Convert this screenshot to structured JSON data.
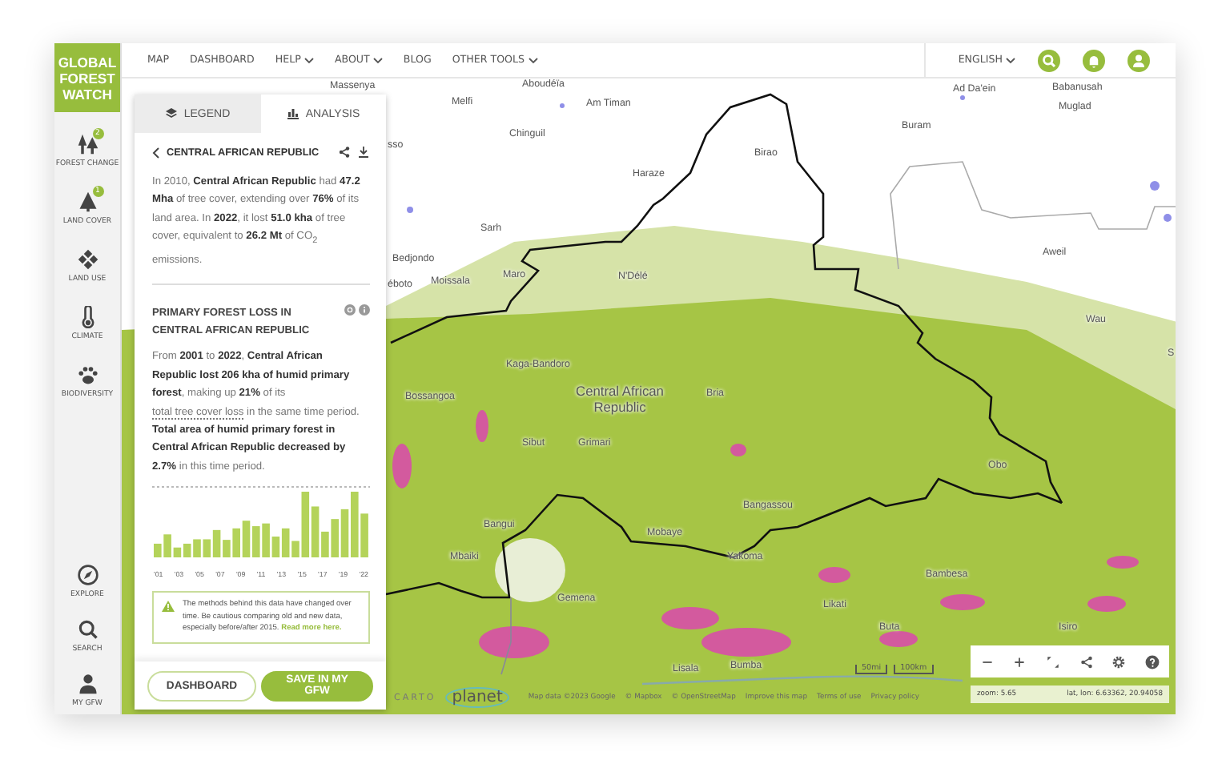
{
  "logo": {
    "lines": [
      "GLOBAL",
      "FOREST",
      "WATCH"
    ]
  },
  "sidebar": {
    "items": [
      {
        "label": "FOREST CHANGE",
        "badge": "2",
        "kind": "trees"
      },
      {
        "label": "LAND COVER",
        "badge": "1",
        "kind": "tree"
      },
      {
        "label": "LAND USE",
        "kind": "grid"
      },
      {
        "label": "CLIMATE",
        "kind": "thermometer"
      },
      {
        "label": "BIODIVERSITY",
        "kind": "paw"
      }
    ],
    "bottom_items": [
      {
        "label": "EXPLORE",
        "kind": "compass"
      },
      {
        "label": "SEARCH",
        "kind": "search"
      },
      {
        "label": "MY GFW",
        "kind": "person"
      }
    ]
  },
  "nav": {
    "items": [
      {
        "label": "MAP",
        "dropdown": false
      },
      {
        "label": "DASHBOARD",
        "dropdown": false
      },
      {
        "label": "HELP",
        "dropdown": true
      },
      {
        "label": "ABOUT",
        "dropdown": true
      },
      {
        "label": "BLOG",
        "dropdown": false
      },
      {
        "label": "OTHER TOOLS",
        "dropdown": true
      }
    ],
    "language": "ENGLISH",
    "actions": [
      {
        "kind": "search"
      },
      {
        "kind": "bell"
      },
      {
        "kind": "user"
      }
    ]
  },
  "panel": {
    "tabs": [
      {
        "label": "LEGEND",
        "selected": false,
        "kind": "layers"
      },
      {
        "label": "ANALYSIS",
        "selected": true,
        "kind": "chart"
      }
    ],
    "title": "CENTRAL AFRICAN REPUBLIC",
    "summary": "In 2010, **Central African Republic** had **47.2 Mha** of tree cover, extending over **76%** of its land area. In **2022**, it lost **51.0 kha** of tree cover, equivalent to **26.2 Mt** of CO$_{2}$ emissions.",
    "widget": {
      "title": "PRIMARY FOREST LOSS IN CENTRAL AFRICAN REPUBLIC",
      "text_before": "From **2001** to **2022**, **Central African Republic lost 206 kha of humid primary forest**, making up **21%** of its ",
      "link": "total tree cover loss",
      "text_after": " in the same time period. **Total area of humid primary forest in Central African Republic decreased by 2.7%** in this time period.",
      "chart_labels": [
        "'01",
        "'03",
        "'05",
        "'07",
        "'09",
        "'11",
        "'13",
        "'15",
        "'17",
        "'19",
        "'22"
      ],
      "warning": {
        "text": "The methods behind this data have changed over time. Be cautious comparing old and new data, especially before/after 2015.",
        "link": "Read more here."
      }
    },
    "buttons": [
      {
        "label": "DASHBOARD",
        "kind": "outline"
      },
      {
        "label": "SAVE IN MY GFW",
        "kind": "filled"
      }
    ]
  },
  "map": {
    "labels": [
      "Massenya",
      "Aboudéïa",
      "Melfi",
      "Am Timan",
      "Chinguil",
      "Haraze",
      "Birao",
      "Buram",
      "Ad Da'ein",
      "Babanusah",
      "Muglad",
      "Sarh",
      "Bedjondo",
      "Moissala",
      "Maro",
      "N'Délé",
      "Aweil",
      "Wau",
      "S",
      "Kaga-Bandoro",
      "Bossangoa",
      "Bria",
      "Sibut",
      "Grimari",
      "Obo",
      "Bangassou",
      "Bangui",
      "Mbaiki",
      "Mobaye",
      "Yakoma",
      "Gemena",
      "Bambesa",
      "Likati",
      "Buta",
      "Isiro",
      "Lisala",
      "Bumba",
      "sso",
      "éboto"
    ],
    "country_label": "Central African Republic",
    "scale": [
      "50mi",
      "100km"
    ],
    "carto": "CARTO",
    "planet": "planet",
    "attribution": [
      "Map data ©2023 Google",
      "© Mapbox",
      "© OpenStreetMap",
      "Improve this map",
      "Terms of use",
      "Privacy policy"
    ],
    "controls": [
      {
        "kind": "minus"
      },
      {
        "kind": "plus"
      },
      {
        "kind": "expand"
      },
      {
        "kind": "share"
      },
      {
        "kind": "settings"
      },
      {
        "kind": "help"
      }
    ],
    "status": {
      "zoom": "zoom: 5.65",
      "coords": "lat, lon: 6.63362, 20.94058"
    }
  }
}
